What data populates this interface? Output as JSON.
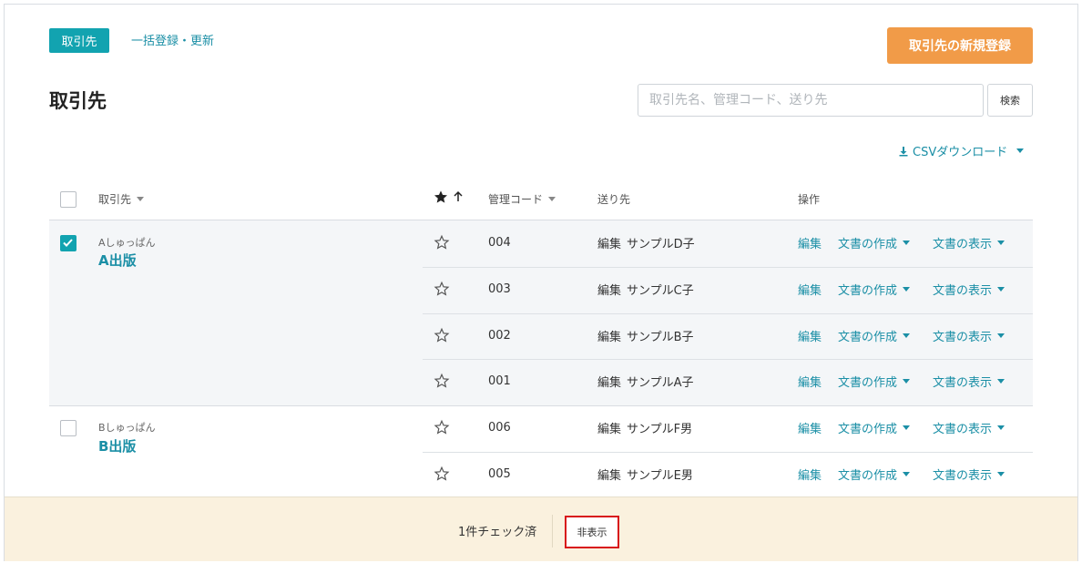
{
  "tabs": {
    "active": "取引先",
    "bulk": "一括登録・更新"
  },
  "new_button": "取引先の新規登録",
  "page_title": "取引先",
  "search": {
    "placeholder": "取引先名、管理コード、送り先",
    "button": "検索"
  },
  "csv_download": "CSVダウンロード",
  "table": {
    "headers": {
      "partner": "取引先",
      "code": "管理コード",
      "destination": "送り先",
      "actions": "操作"
    },
    "groups": [
      {
        "kana": "Aしゅっぱん",
        "name": "A出版",
        "checked": true,
        "rows": [
          {
            "code": "004",
            "edit": "編集",
            "dest": "サンプルD子"
          },
          {
            "code": "003",
            "edit": "編集",
            "dest": "サンプルC子"
          },
          {
            "code": "002",
            "edit": "編集",
            "dest": "サンプルB子"
          },
          {
            "code": "001",
            "edit": "編集",
            "dest": "サンプルA子"
          }
        ]
      },
      {
        "kana": "Bしゅっぱん",
        "name": "B出版",
        "checked": false,
        "rows": [
          {
            "code": "006",
            "edit": "編集",
            "dest": "サンプルF男"
          },
          {
            "code": "005",
            "edit": "編集",
            "dest": "サンプルE男"
          }
        ]
      }
    ],
    "actions": {
      "edit": "編集",
      "create_doc": "文書の作成",
      "show_doc": "文書の表示"
    }
  },
  "footer": {
    "checked_count": "1件チェック済",
    "hide_button": "非表示"
  },
  "colors": {
    "accent": "#12a3b0",
    "link": "#1b8fa6",
    "primary_button": "#f19b48",
    "footer_bg": "#faf1de",
    "highlight_border": "#d8141a"
  }
}
